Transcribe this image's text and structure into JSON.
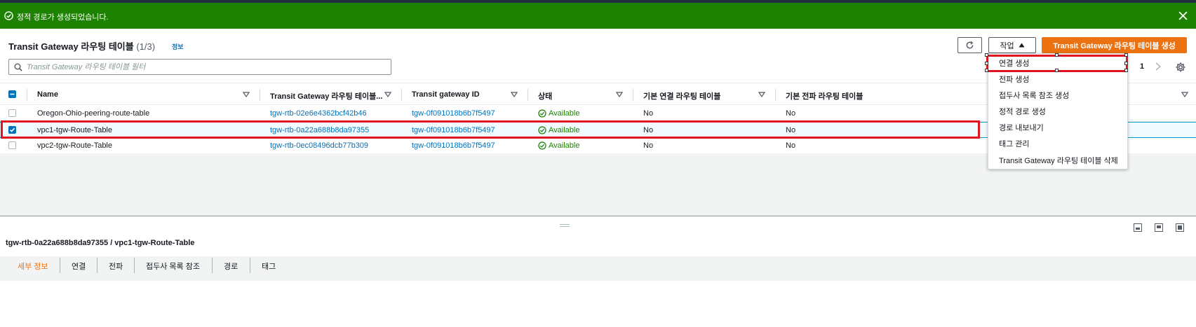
{
  "flash": {
    "message": "정적 경로가 생성되었습니다.",
    "color": "#1d8102"
  },
  "header": {
    "title": "Transit Gateway 라우팅 테이블",
    "count": "(1/3)",
    "info": "정보",
    "actions_label": "작업",
    "create_label": "Transit Gateway 라우팅 테이블 생성",
    "accent": "#ec7211"
  },
  "search": {
    "placeholder": "Transit Gateway 라우팅 테이블 필터",
    "value": ""
  },
  "pagination": {
    "page": "1"
  },
  "table": {
    "columns": [
      "Name",
      "Transit Gateway 라우팅 테이블...",
      "Transit gateway ID",
      "상태",
      "기본 연결 라우팅 테이블",
      "기본 전파 라우팅 테이블"
    ],
    "rows": [
      {
        "name": "Oregon-Ohio-peering-route-table",
        "rtb_id": "tgw-rtb-02e6e4362bcf42b46",
        "tgw_id": "tgw-0f091018b6b7f5497",
        "status": "Available",
        "assoc": "No",
        "prop": "No",
        "selected": false
      },
      {
        "name": "vpc1-tgw-Route-Table",
        "rtb_id": "tgw-rtb-0a22a688b8da97355",
        "tgw_id": "tgw-0f091018b6b7f5497",
        "status": "Available",
        "assoc": "No",
        "prop": "No",
        "selected": true
      },
      {
        "name": "vpc2-tgw-Route-Table",
        "rtb_id": "tgw-rtb-0ec08496dcb77b309",
        "tgw_id": "tgw-0f091018b6b7f5497",
        "status": "Available",
        "assoc": "No",
        "prop": "No",
        "selected": false
      }
    ]
  },
  "dropdown": {
    "items": [
      "연결 생성",
      "전파 생성",
      "접두사 목록 참조 생성",
      "정적 경로 생성",
      "경로 내보내기",
      "태그 관리",
      "Transit Gateway 라우팅 테이블 삭제"
    ]
  },
  "split": {
    "title": "tgw-rtb-0a22a688b8da97355 / vpc1-tgw-Route-Table",
    "tabs": [
      "세부 정보",
      "연결",
      "전파",
      "접두사 목록 참조",
      "경로",
      "태그"
    ]
  }
}
